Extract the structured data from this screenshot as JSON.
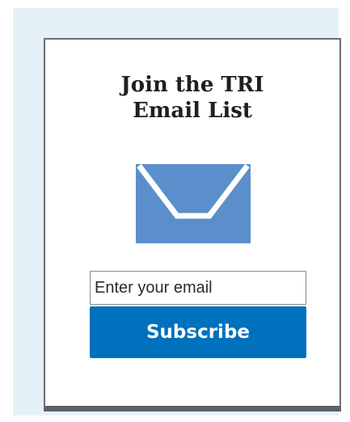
{
  "signup": {
    "title_line1": "Join the TRI",
    "title_line2": "Email List",
    "email_placeholder": "Enter your email",
    "email_value": "",
    "subscribe_label": "Subscribe"
  },
  "icons": {
    "envelope": "envelope-icon"
  },
  "colors": {
    "background": "#e4f1f8",
    "card_border": "#6b6f74",
    "envelope": "#5b8fcb",
    "button": "#0071bc",
    "button_text": "#ffffff"
  }
}
